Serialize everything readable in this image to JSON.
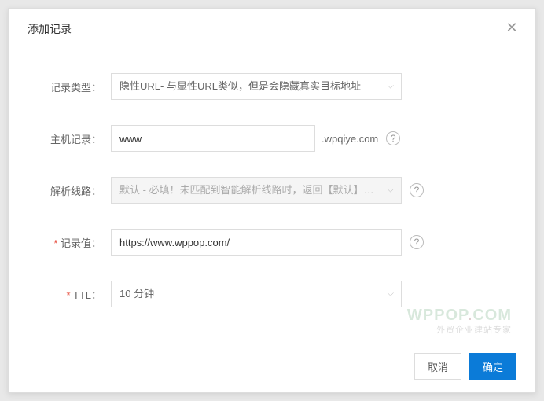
{
  "modal": {
    "title": "添加记录"
  },
  "form": {
    "recordType": {
      "label": "记录类型：",
      "value": "隐性URL- 与显性URL类似，但是会隐藏真实目标地址"
    },
    "hostRecord": {
      "label": "主机记录：",
      "value": "www",
      "suffix": ".wpqiye.com"
    },
    "resolveLine": {
      "label": "解析线路：",
      "value": "默认 - 必填！未匹配到智能解析线路时，返回【默认】线路设..."
    },
    "recordValue": {
      "label": "记录值：",
      "value": "https://www.wppop.com/"
    },
    "ttl": {
      "label": "TTL：",
      "value": "10 分钟"
    }
  },
  "footer": {
    "cancel": "取消",
    "confirm": "确定"
  },
  "watermark": {
    "main1": "WPPOP",
    "main2": "COM",
    "sub": "外贸企业建站专家"
  }
}
